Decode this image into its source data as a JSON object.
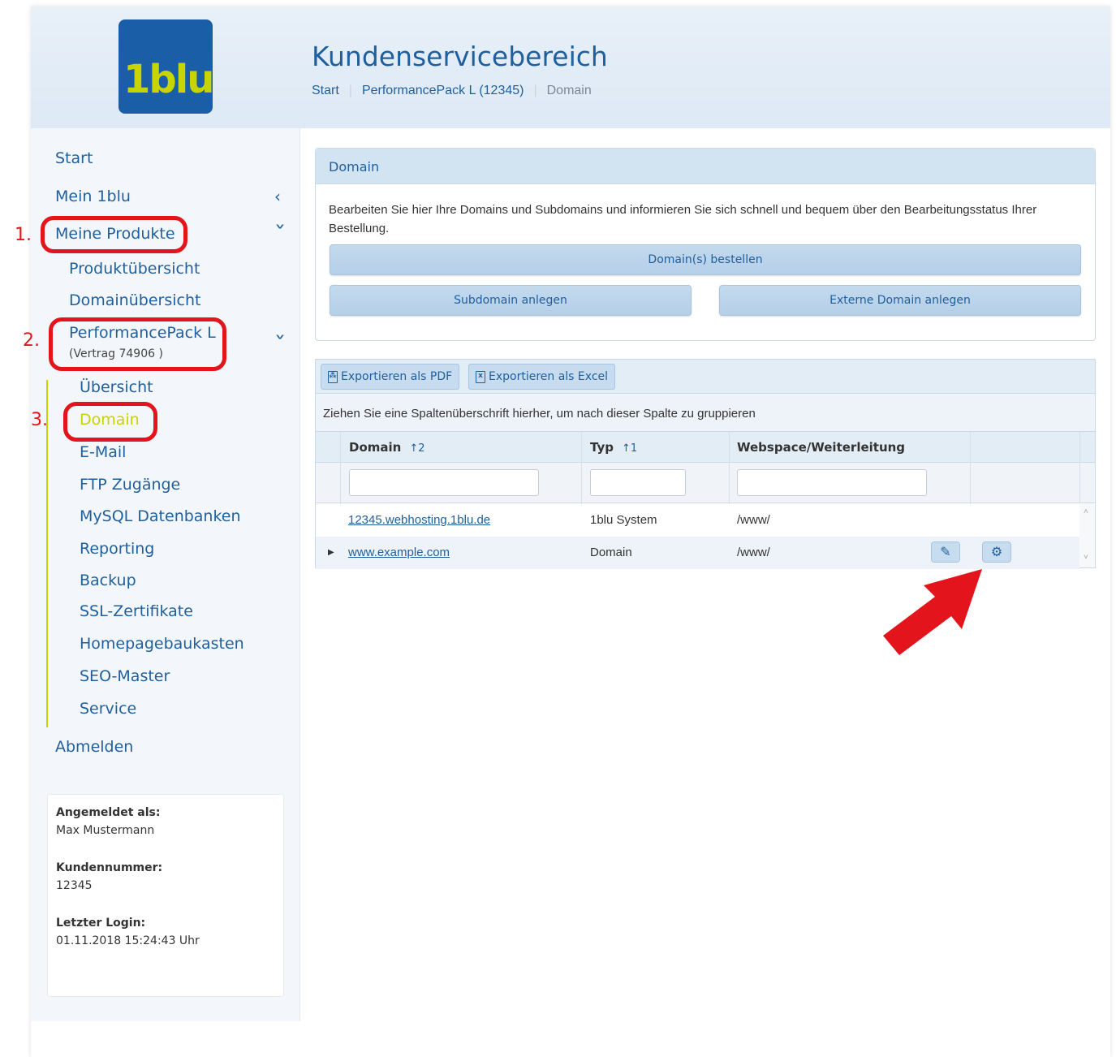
{
  "header": {
    "logo_text": "1blu",
    "title": "Kundenservicebereich",
    "breadcrumb": [
      "Start",
      "PerformancePack L (12345)",
      "Domain"
    ]
  },
  "sidebar": {
    "start": "Start",
    "mein": "Mein 1blu",
    "meine_produkte": "Meine Produkte",
    "produktuebersicht": "Produktübersicht",
    "domainuebersicht": "Domainübersicht",
    "pack": "PerformancePack L",
    "contract": "(Vertrag 74906 )",
    "items": [
      "Übersicht",
      "Domain",
      "E-Mail",
      "FTP Zugänge",
      "MySQL Datenbanken",
      "Reporting",
      "Backup",
      "SSL-Zertifikate",
      "Homepagebaukasten",
      "SEO-Master",
      "Service"
    ],
    "logout": "Abmelden",
    "user": {
      "logged_label": "Angemeldet als:",
      "logged_value": "Max Mustermann",
      "customer_label": "Kundennummer:",
      "customer_value": "12345",
      "login_label": "Letzter Login:",
      "login_value": "01.11.2018 15:24:43 Uhr"
    }
  },
  "domain_card": {
    "title": "Domain",
    "text": "Bearbeiten Sie hier Ihre Domains und Subdomains und informieren Sie sich schnell und bequem über den Bearbeitungsstatus Ihrer Bestellung.",
    "btn_order": "Domain(s) bestellen",
    "btn_sub": "Subdomain anlegen",
    "btn_ext": "Externe Domain anlegen"
  },
  "grid": {
    "export_pdf": "Exportieren als PDF",
    "export_excel": "Exportieren als Excel",
    "group_hint": "Ziehen Sie eine Spaltenüberschrift hierher, um nach dieser Spalte zu gruppieren",
    "columns": [
      {
        "label": "Domain",
        "sort": "↑2"
      },
      {
        "label": "Typ",
        "sort": "↑1"
      },
      {
        "label": "Webspace/Weiterleitung",
        "sort": ""
      }
    ],
    "rows": [
      {
        "domain": "12345.webhosting.1blu.de",
        "type": "1blu System",
        "webspace": "/www/"
      },
      {
        "domain": "www.example.com",
        "type": "Domain",
        "webspace": "/www/"
      }
    ]
  },
  "annotations": [
    "1.",
    "2.",
    "3."
  ],
  "colors": {
    "brand": "#1b5ea8",
    "accent": "#c8d400",
    "annotation": "#e3141b"
  }
}
